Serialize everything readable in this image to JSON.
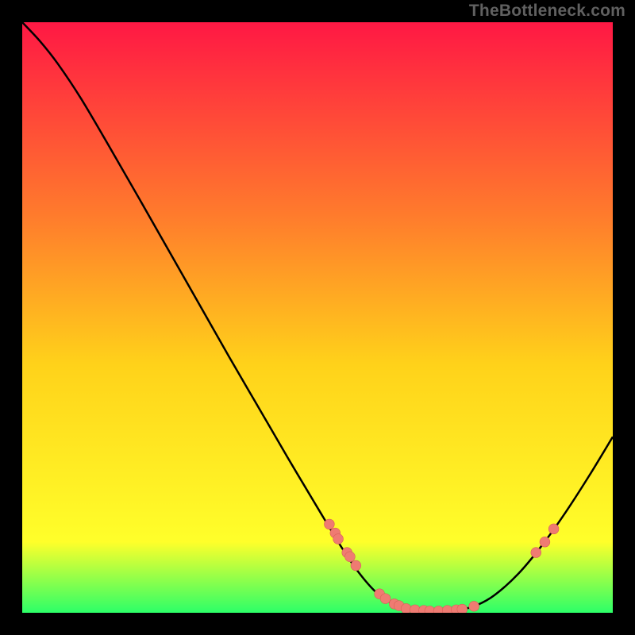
{
  "watermark": "TheBottleneck.com",
  "colors": {
    "gradient_top": "#ff1844",
    "gradient_mid1": "#ff7c2c",
    "gradient_mid2": "#ffd21a",
    "gradient_mid3": "#ffff2a",
    "gradient_bottom": "#2cff68",
    "curve": "#000000",
    "dot_fill": "#ef7b72",
    "dot_stroke": "#d86058",
    "frame_bg": "#000000"
  },
  "chart_data": {
    "type": "line",
    "title": "",
    "xlabel": "",
    "ylabel": "",
    "xlim": [
      0,
      100
    ],
    "ylim": [
      0,
      100
    ],
    "curve": [
      {
        "x": 0.0,
        "y": 100.0
      },
      {
        "x": 3.0,
        "y": 96.8
      },
      {
        "x": 6.0,
        "y": 93.0
      },
      {
        "x": 10.0,
        "y": 87.0
      },
      {
        "x": 15.0,
        "y": 78.5
      },
      {
        "x": 20.0,
        "y": 69.8
      },
      {
        "x": 25.0,
        "y": 61.0
      },
      {
        "x": 30.0,
        "y": 52.2
      },
      {
        "x": 35.0,
        "y": 43.4
      },
      {
        "x": 40.0,
        "y": 34.8
      },
      {
        "x": 45.0,
        "y": 26.2
      },
      {
        "x": 50.0,
        "y": 17.8
      },
      {
        "x": 54.0,
        "y": 11.2
      },
      {
        "x": 57.0,
        "y": 6.8
      },
      {
        "x": 60.0,
        "y": 3.4
      },
      {
        "x": 63.0,
        "y": 1.4
      },
      {
        "x": 66.0,
        "y": 0.5
      },
      {
        "x": 70.0,
        "y": 0.3
      },
      {
        "x": 74.0,
        "y": 0.5
      },
      {
        "x": 77.0,
        "y": 1.3
      },
      {
        "x": 80.0,
        "y": 3.0
      },
      {
        "x": 84.0,
        "y": 6.6
      },
      {
        "x": 88.0,
        "y": 11.4
      },
      {
        "x": 92.0,
        "y": 17.0
      },
      {
        "x": 96.0,
        "y": 23.2
      },
      {
        "x": 100.0,
        "y": 29.8
      }
    ],
    "dots": [
      {
        "x": 52.0,
        "y": 15.0
      },
      {
        "x": 53.0,
        "y": 13.5
      },
      {
        "x": 53.5,
        "y": 12.5
      },
      {
        "x": 55.0,
        "y": 10.2
      },
      {
        "x": 55.5,
        "y": 9.5
      },
      {
        "x": 56.5,
        "y": 8.0
      },
      {
        "x": 60.5,
        "y": 3.2
      },
      {
        "x": 61.5,
        "y": 2.4
      },
      {
        "x": 63.0,
        "y": 1.5
      },
      {
        "x": 63.8,
        "y": 1.2
      },
      {
        "x": 65.0,
        "y": 0.7
      },
      {
        "x": 66.5,
        "y": 0.5
      },
      {
        "x": 68.0,
        "y": 0.4
      },
      {
        "x": 69.0,
        "y": 0.3
      },
      {
        "x": 70.5,
        "y": 0.3
      },
      {
        "x": 72.0,
        "y": 0.4
      },
      {
        "x": 73.5,
        "y": 0.5
      },
      {
        "x": 74.5,
        "y": 0.6
      },
      {
        "x": 76.5,
        "y": 1.1
      },
      {
        "x": 87.0,
        "y": 10.2
      },
      {
        "x": 88.5,
        "y": 12.0
      },
      {
        "x": 90.0,
        "y": 14.2
      }
    ]
  }
}
